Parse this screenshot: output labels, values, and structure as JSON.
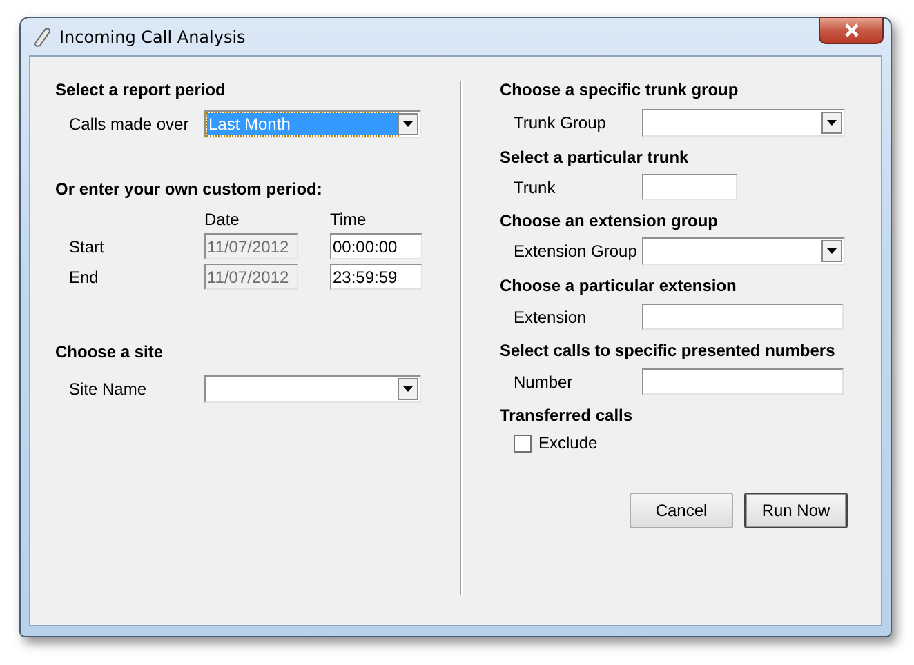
{
  "window": {
    "title": "Incoming Call Analysis"
  },
  "report_period": {
    "heading": "Select a report period",
    "label": "Calls made over",
    "dropdown": {
      "value": "Last Month",
      "focused": true
    }
  },
  "custom_period": {
    "heading": "Or enter your own custom period:",
    "date_header": "Date",
    "time_header": "Time",
    "rows": [
      {
        "label": "Start",
        "date": {
          "value": "11/07/2012",
          "disabled": true
        },
        "time": {
          "value": "00:00:00",
          "disabled": false
        }
      },
      {
        "label": "End",
        "date": {
          "value": "11/07/2012",
          "disabled": true
        },
        "time": {
          "value": "23:59:59",
          "disabled": false
        }
      }
    ]
  },
  "site": {
    "heading": "Choose a site",
    "label": "Site Name"
  },
  "filters": [
    {
      "kind": "dropdown",
      "heading": "Choose a specific trunk group",
      "label": "Trunk Group"
    },
    {
      "kind": "short_text",
      "heading": "Select a particular trunk",
      "label": "Trunk"
    },
    {
      "kind": "dropdown",
      "heading": "Choose an extension group",
      "label": "Extension Group"
    },
    {
      "kind": "text",
      "heading": "Choose a particular extension",
      "label": "Extension"
    },
    {
      "kind": "text",
      "heading": "Select calls to specific presented numbers",
      "label": "Number"
    },
    {
      "kind": "checkbox",
      "heading": "Transferred calls",
      "label": "Exclude",
      "checked": false
    }
  ],
  "buttons": [
    {
      "label": "Cancel",
      "default": false
    },
    {
      "label": "Run Now",
      "default": true
    }
  ]
}
